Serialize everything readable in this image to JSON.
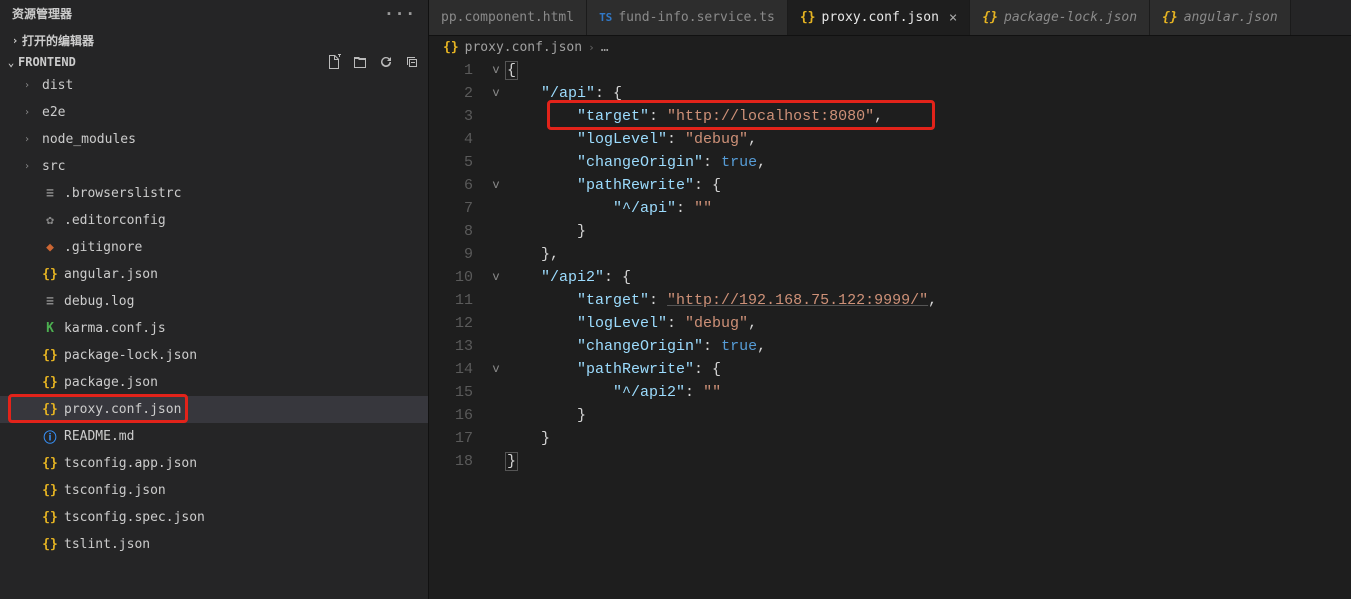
{
  "explorer_title": "资源管理器",
  "open_editors": "打开的编辑器",
  "project": "FRONTEND",
  "folders": [
    {
      "name": "dist"
    },
    {
      "name": "e2e"
    },
    {
      "name": "node_modules"
    },
    {
      "name": "src"
    }
  ],
  "files": [
    {
      "name": ".browserslistrc",
      "icon": "lines"
    },
    {
      "name": ".editorconfig",
      "icon": "gear"
    },
    {
      "name": ".gitignore",
      "icon": "git"
    },
    {
      "name": "angular.json",
      "icon": "braces"
    },
    {
      "name": "debug.log",
      "icon": "lines"
    },
    {
      "name": "karma.conf.js",
      "icon": "karma"
    },
    {
      "name": "package-lock.json",
      "icon": "braces"
    },
    {
      "name": "package.json",
      "icon": "braces"
    },
    {
      "name": "proxy.conf.json",
      "icon": "braces",
      "active": true,
      "highlight": true
    },
    {
      "name": "README.md",
      "icon": "info"
    },
    {
      "name": "tsconfig.app.json",
      "icon": "braces"
    },
    {
      "name": "tsconfig.json",
      "icon": "braces"
    },
    {
      "name": "tsconfig.spec.json",
      "icon": "braces"
    },
    {
      "name": "tslint.json",
      "icon": "braces"
    }
  ],
  "tabs": [
    {
      "label": "pp.component.html",
      "icon": "",
      "active": false
    },
    {
      "label": "fund-info.service.ts",
      "icon": "ts",
      "active": false
    },
    {
      "label": "proxy.conf.json",
      "icon": "braces",
      "active": true,
      "close": true
    },
    {
      "label": "package-lock.json",
      "icon": "braces",
      "active": false,
      "italic": true
    },
    {
      "label": "angular.json",
      "icon": "braces",
      "active": false,
      "italic": true
    }
  ],
  "breadcrumb_file": "proxy.conf.json",
  "breadcrumb_tail": "…",
  "line_numbers": [
    "1",
    "2",
    "3",
    "4",
    "5",
    "6",
    "7",
    "8",
    "9",
    "10",
    "11",
    "12",
    "13",
    "14",
    "15",
    "16",
    "17",
    "18"
  ],
  "fold": [
    "v",
    "v",
    "",
    "",
    "",
    "v",
    "",
    "",
    "",
    "v",
    "",
    "",
    "",
    "v",
    "",
    "",
    "",
    ""
  ],
  "code": {
    "l1": "{",
    "api_key": "\"/api\"",
    "target_key": "\"target\"",
    "target_val": "\"http://localhost:8080\"",
    "loglevel_key": "\"logLevel\"",
    "loglevel_val": "\"debug\"",
    "changeorigin_key": "\"changeOrigin\"",
    "true_val": "true",
    "pathrewrite_key": "\"pathRewrite\"",
    "caret_api": "\"^/api\"",
    "empty_str": "\"\"",
    "api2_key": "\"/api2\"",
    "target2_val": "\"http://192.168.75.122:9999/\"",
    "caret_api2": "\"^/api2\""
  }
}
